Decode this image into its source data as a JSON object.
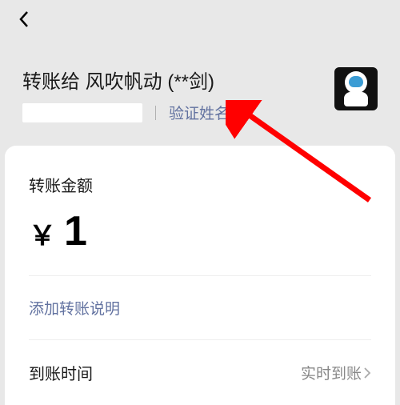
{
  "header": {
    "back_icon": "chevron-left"
  },
  "recipient": {
    "title_prefix": "转账给",
    "nickname": "风吹帆动",
    "masked_realname": "(**剑)",
    "verify_link": "验证姓名"
  },
  "transfer": {
    "amount_label": "转账金额",
    "currency_symbol": "￥",
    "amount": "1",
    "memo_link": "添加转账说明",
    "arrival_label": "到账时间",
    "arrival_value": "实时到账"
  },
  "annotation": {
    "arrow_color": "#ff0000"
  }
}
